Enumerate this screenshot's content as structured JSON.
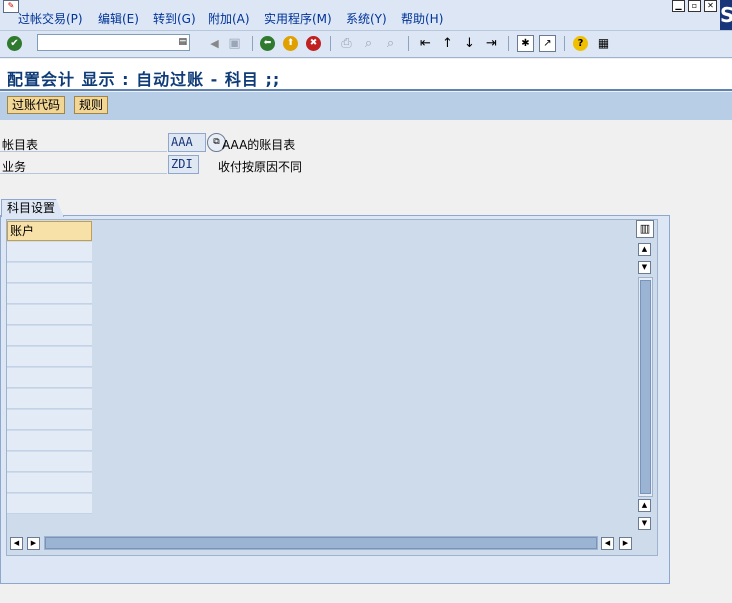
{
  "menu": {
    "items": [
      "过帐交易(P)",
      "编辑(E)",
      "转到(G)",
      "附加(A)",
      "实用程序(M)",
      "系统(Y)",
      "帮助(H)"
    ]
  },
  "window": {
    "minimize": "▁",
    "restore": "▫",
    "close": "✕",
    "logo": "S"
  },
  "toolbar": {
    "command_value": "",
    "enter_icon": "✔",
    "back_icon": "⬅",
    "exit_icon": "⬆",
    "cancel_icon": "✖",
    "help_icon": "?"
  },
  "title": "配置会计 显示 : 自动过账 - 科目 ;;",
  "app_toolbar": {
    "posting_key": "过账代码",
    "rules": "规则"
  },
  "fields": {
    "chart_of_accounts": {
      "label": "帐目表",
      "value": "AAA",
      "description": "AAA的账目表"
    },
    "transaction": {
      "label": "业务",
      "value": "ZDI",
      "description": "收付按原因不同"
    }
  },
  "tab": {
    "label": "科目设置"
  },
  "table": {
    "column_header": "账户",
    "rows": [
      "",
      "",
      "",
      "",
      "",
      "",
      "",
      "",
      "",
      "",
      "",
      "",
      "",
      "",
      ""
    ]
  },
  "colors": {
    "menu_bar": "#dce6f4",
    "title_text": "#0f3c78",
    "button": "#f2d696",
    "panel": "#dce6f4"
  }
}
